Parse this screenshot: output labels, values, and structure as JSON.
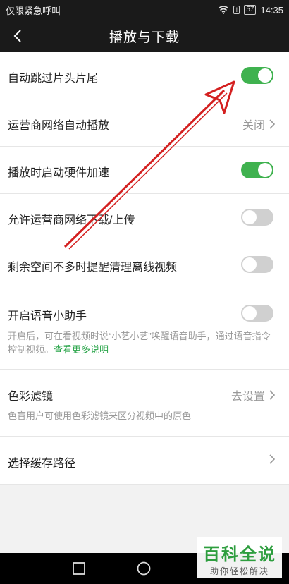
{
  "status_bar": {
    "carrier": "仅限紧急呼叫",
    "battery": "57",
    "alert": "!",
    "time": "14:35"
  },
  "header": {
    "title": "播放与下载",
    "back_icon": "chevron-left-icon"
  },
  "settings": {
    "skip_intro": {
      "label": "自动跳过片头片尾",
      "enabled": true
    },
    "carrier_autoplay": {
      "label": "运营商网络自动播放",
      "value": "关闭"
    },
    "hw_accel": {
      "label": "播放时启动硬件加速",
      "enabled": true
    },
    "carrier_download": {
      "label": "允许运营商网络下载/上传",
      "enabled": false
    },
    "low_space_reminder": {
      "label": "剩余空间不多时提醒清理离线视频",
      "enabled": false
    },
    "voice_assistant": {
      "label": "开启语音小助手",
      "enabled": false,
      "desc": "开启后，可在看视频时说“小艺小艺”唤醒语音助手，通过语音指令控制视频。",
      "link": "查看更多说明"
    },
    "color_filter": {
      "label": "色彩滤镜",
      "value": "去设置",
      "desc": "色盲用户可使用色彩滤镜来区分视频中的原色"
    },
    "cache_path": {
      "label": "选择缓存路径"
    }
  },
  "colors": {
    "toggle_on": "#3fb24f",
    "toggle_off": "#d0d0d0",
    "link": "#2aa54a",
    "annotation_arrow": "#d42020"
  },
  "watermark": {
    "big": "百科全说",
    "small": "助你轻松解决"
  }
}
